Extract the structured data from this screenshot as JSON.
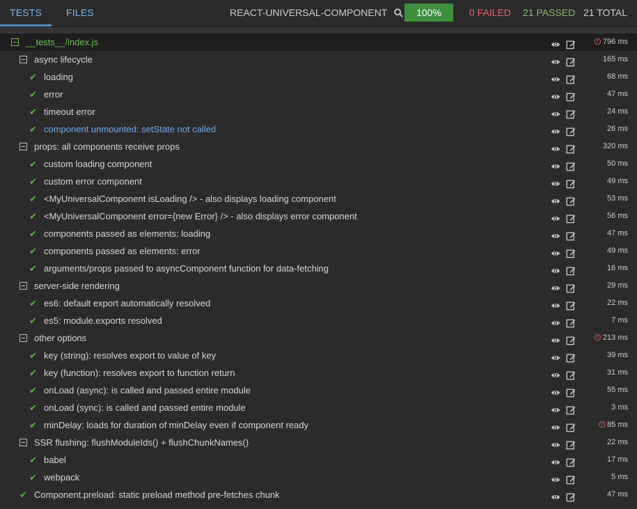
{
  "tabs": {
    "tests": "TESTS",
    "files": "FILES"
  },
  "project": {
    "name": "REACT-UNIVERSAL-COMPONENT"
  },
  "summary": {
    "coverage": "100%",
    "failed": "0 FAILED",
    "passed": "21 PASSED",
    "total": "21 TOTAL"
  },
  "colors": {
    "passed": "#86c06b",
    "failed": "#e06a66",
    "coverage_bg": "#3f8f3f",
    "link": "#6cacee"
  },
  "rows": [
    {
      "kind": "file",
      "level": 0,
      "label": "__tests__/index.js",
      "time": "796 ms",
      "warn": true
    },
    {
      "kind": "suite",
      "level": 1,
      "label": "async lifecycle",
      "time": "165 ms"
    },
    {
      "kind": "test",
      "level": 2,
      "label": "loading",
      "time": "68 ms"
    },
    {
      "kind": "test",
      "level": 2,
      "label": "error",
      "time": "47 ms"
    },
    {
      "kind": "test",
      "level": 2,
      "label": "timeout error",
      "time": "24 ms"
    },
    {
      "kind": "test",
      "level": 2,
      "label": "component unmounted: setState not called",
      "time": "26 ms",
      "highlight": true
    },
    {
      "kind": "suite",
      "level": 1,
      "label": "props: all components receive props",
      "time": "320 ms"
    },
    {
      "kind": "test",
      "level": 2,
      "label": "custom loading component",
      "time": "50 ms"
    },
    {
      "kind": "test",
      "level": 2,
      "label": "custom error component",
      "time": "49 ms"
    },
    {
      "kind": "test",
      "level": 2,
      "label": "<MyUniversalComponent isLoading /> - also displays loading component",
      "time": "53 ms"
    },
    {
      "kind": "test",
      "level": 2,
      "label": "<MyUniversalComponent error={new Error} /> - also displays error component",
      "time": "56 ms"
    },
    {
      "kind": "test",
      "level": 2,
      "label": "components passed as elements: loading",
      "time": "47 ms"
    },
    {
      "kind": "test",
      "level": 2,
      "label": "components passed as elements: error",
      "time": "49 ms"
    },
    {
      "kind": "test",
      "level": 2,
      "label": "arguments/props passed to asyncComponent function for data-fetching",
      "time": "16 ms"
    },
    {
      "kind": "suite",
      "level": 1,
      "label": "server-side rendering",
      "time": "29 ms"
    },
    {
      "kind": "test",
      "level": 2,
      "label": "es6: default export automatically resolved",
      "time": "22 ms"
    },
    {
      "kind": "test",
      "level": 2,
      "label": "es5: module.exports resolved",
      "time": "7 ms"
    },
    {
      "kind": "suite",
      "level": 1,
      "label": "other options",
      "time": "213 ms",
      "warn": true
    },
    {
      "kind": "test",
      "level": 2,
      "label": "key (string): resolves export to value of key",
      "time": "39 ms"
    },
    {
      "kind": "test",
      "level": 2,
      "label": "key (function): resolves export to function return",
      "time": "31 ms"
    },
    {
      "kind": "test",
      "level": 2,
      "label": "onLoad (async): is called and passed entire module",
      "time": "55 ms"
    },
    {
      "kind": "test",
      "level": 2,
      "label": "onLoad (sync): is called and passed entire module",
      "time": "3 ms"
    },
    {
      "kind": "test",
      "level": 2,
      "label": "minDelay: loads for duration of minDelay even if component ready",
      "time": "85 ms",
      "warn": true
    },
    {
      "kind": "suite",
      "level": 1,
      "label": "SSR flushing: flushModuleIds() + flushChunkNames()",
      "time": "22 ms"
    },
    {
      "kind": "test",
      "level": 2,
      "label": "babel",
      "time": "17 ms"
    },
    {
      "kind": "test",
      "level": 2,
      "label": "webpack",
      "time": "5 ms"
    },
    {
      "kind": "test",
      "level": 1,
      "label": "Component.preload: static preload method pre-fetches chunk",
      "time": "47 ms"
    }
  ]
}
